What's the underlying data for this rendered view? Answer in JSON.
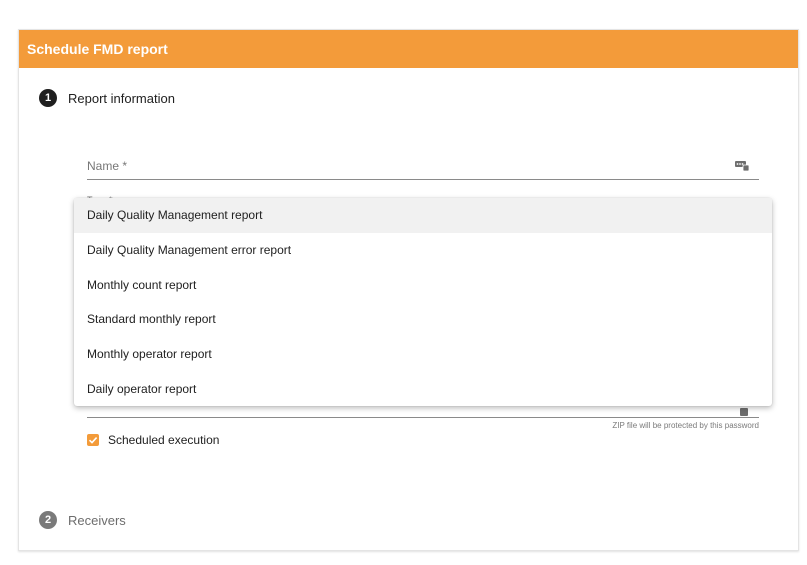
{
  "header": {
    "title": "Schedule FMD report"
  },
  "steps": [
    {
      "number": "1",
      "label": "Report information"
    },
    {
      "number": "2",
      "label": "Receivers"
    }
  ],
  "form": {
    "name_placeholder": "Name *",
    "name_icon": "password-manager-icon",
    "type_label_partial": "Type *",
    "password_icon": "password-manager-icon",
    "password_hint": "ZIP file will be protected by this password",
    "scheduled_execution_label": "Scheduled execution",
    "scheduled_execution_checked": true
  },
  "dropdown": {
    "options": [
      "Daily Quality Management report",
      "Daily Quality Management error report",
      "Monthly count report",
      "Standard monthly report",
      "Monthly operator report",
      "Daily operator report"
    ],
    "highlighted_index": 0
  },
  "colors": {
    "accent": "#f39b3a",
    "step_active": "#1f1f1f",
    "step_inactive": "#7a7a7a"
  }
}
